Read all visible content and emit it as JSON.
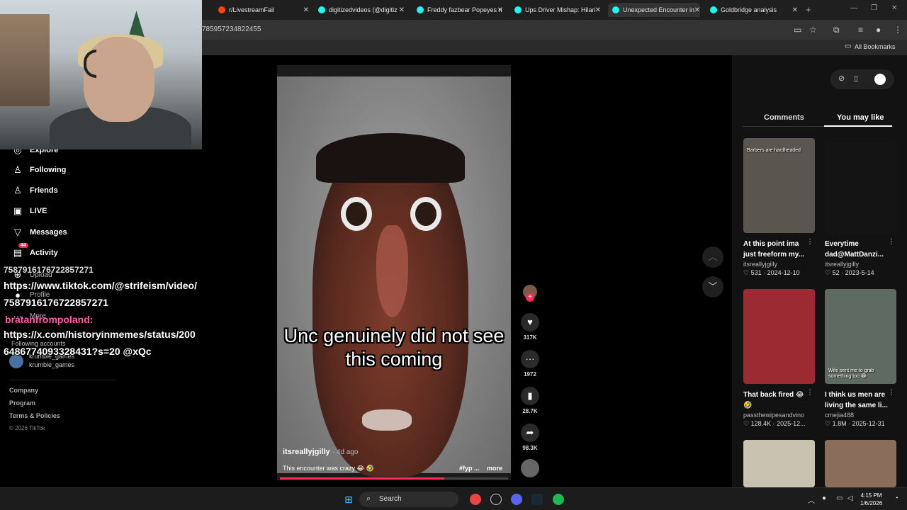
{
  "browser": {
    "tabs": [
      {
        "label": "r/LivestreamFail",
        "color": "#ff4500"
      },
      {
        "label": "digitizedvideos (@digitiz",
        "color": "#25f4ee"
      },
      {
        "label": "Freddy fazbear Popeyes n",
        "color": "#25f4ee"
      },
      {
        "label": "Ups Driver Mishap: Hilari",
        "color": "#25f4ee"
      },
      {
        "label": "Unexpected Encounter in",
        "color": "#25f4ee"
      },
      {
        "label": "Goldbridge analysis",
        "color": "#25f4ee"
      }
    ],
    "url": "785957234822455",
    "bookmarks_label": "All Bookmarks"
  },
  "sidebar": {
    "nav": [
      {
        "label": "Explore",
        "icon": "compass-icon"
      },
      {
        "label": "Following",
        "icon": "following-icon"
      },
      {
        "label": "Friends",
        "icon": "friends-icon"
      },
      {
        "label": "LIVE",
        "icon": "live-icon"
      },
      {
        "label": "Messages",
        "icon": "messages-icon"
      },
      {
        "label": "Activity",
        "icon": "activity-icon",
        "badge": "44"
      },
      {
        "label": "Upload",
        "icon": "upload-icon"
      },
      {
        "label": "Profile",
        "icon": "profile-icon"
      },
      {
        "label": "More",
        "icon": "more-icon"
      }
    ],
    "following_accounts_label": "Following accounts",
    "account": {
      "name": "krumble_games",
      "handle": "krumble_games"
    },
    "footer": [
      "Company",
      "Program",
      "Terms & Policies"
    ],
    "copyright": "© 2026 TikTok"
  },
  "chat": {
    "line0": "7587916176722857271",
    "line1": "https://www.tiktok.com/@strifeism/video/",
    "line2": "7587916176722857271",
    "name": "bratanfrompoland:",
    "line3": "https://x.com/historyinmemes/status/200",
    "line4": "6486774093328431?s=20 @xQc"
  },
  "video": {
    "caption_line1": "Unc genuinely did not see",
    "caption_line2": "this coming",
    "author": "itsreallyjgilly",
    "ago": "· 4d ago",
    "description": "This encounter was crazy 😂 🤣",
    "tag": "#fyp ...",
    "more": "more",
    "progress": 0.72
  },
  "actions": {
    "likes": "317K",
    "comments": "1972",
    "saves": "28.7K",
    "shares": "98.3K"
  },
  "right_panel": {
    "tab_comments": "Comments",
    "tab_you_may_like": "You may like",
    "cards": [
      {
        "overlay": "Barbers are hardheaded",
        "title": "At this point ima just freeform my...",
        "author": "itsreallyjgilly",
        "likes": "531",
        "date": "2024-12-10",
        "bg": "#5b5550"
      },
      {
        "overlay": "",
        "title": "Everytime dad@MattDanzi...",
        "author": "itsreallyjgilly",
        "likes": "52",
        "date": "2023-5-14",
        "bg": "#141414"
      },
      {
        "overlay": "",
        "title": "That back fired 😂 🤣",
        "author": "passthewipesandvino",
        "likes": "128.4K",
        "date": "2025-12...",
        "bg": "#9b2a33"
      },
      {
        "overlay": "Wife sent me to grab something too 😂",
        "title": "I think us men are living the same li...",
        "author": "cmejia488",
        "likes": "1.8M",
        "date": "2025-12-31",
        "bg": "#5e6a62"
      },
      {
        "overlay": "",
        "title": "",
        "author": "",
        "likes": "",
        "date": "",
        "bg": "#c9c2b1"
      },
      {
        "overlay": "",
        "title": "",
        "author": "",
        "likes": "",
        "date": "",
        "bg": "#8a6d5b"
      }
    ]
  },
  "taskbar": {
    "search_label": "Search",
    "time": "4:15 PM",
    "date": "1/6/2026"
  }
}
